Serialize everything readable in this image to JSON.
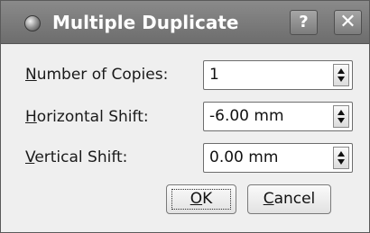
{
  "window": {
    "title": "Multiple Duplicate",
    "app_icon": "inkscape-app-icon",
    "help_button": "?",
    "close_button": "✕"
  },
  "fields": [
    {
      "label_mnemonic": "N",
      "label_rest": "umber of Copies:",
      "value": "1"
    },
    {
      "label_mnemonic": "H",
      "label_rest": "orizontal Shift:",
      "value": "-6.00 mm"
    },
    {
      "label_mnemonic": "V",
      "label_rest": "ertical Shift:",
      "value": "0.00 mm"
    }
  ],
  "buttons": {
    "ok_mnemonic": "O",
    "ok_rest": "K",
    "cancel_mnemonic": "C",
    "cancel_rest": "ancel"
  }
}
